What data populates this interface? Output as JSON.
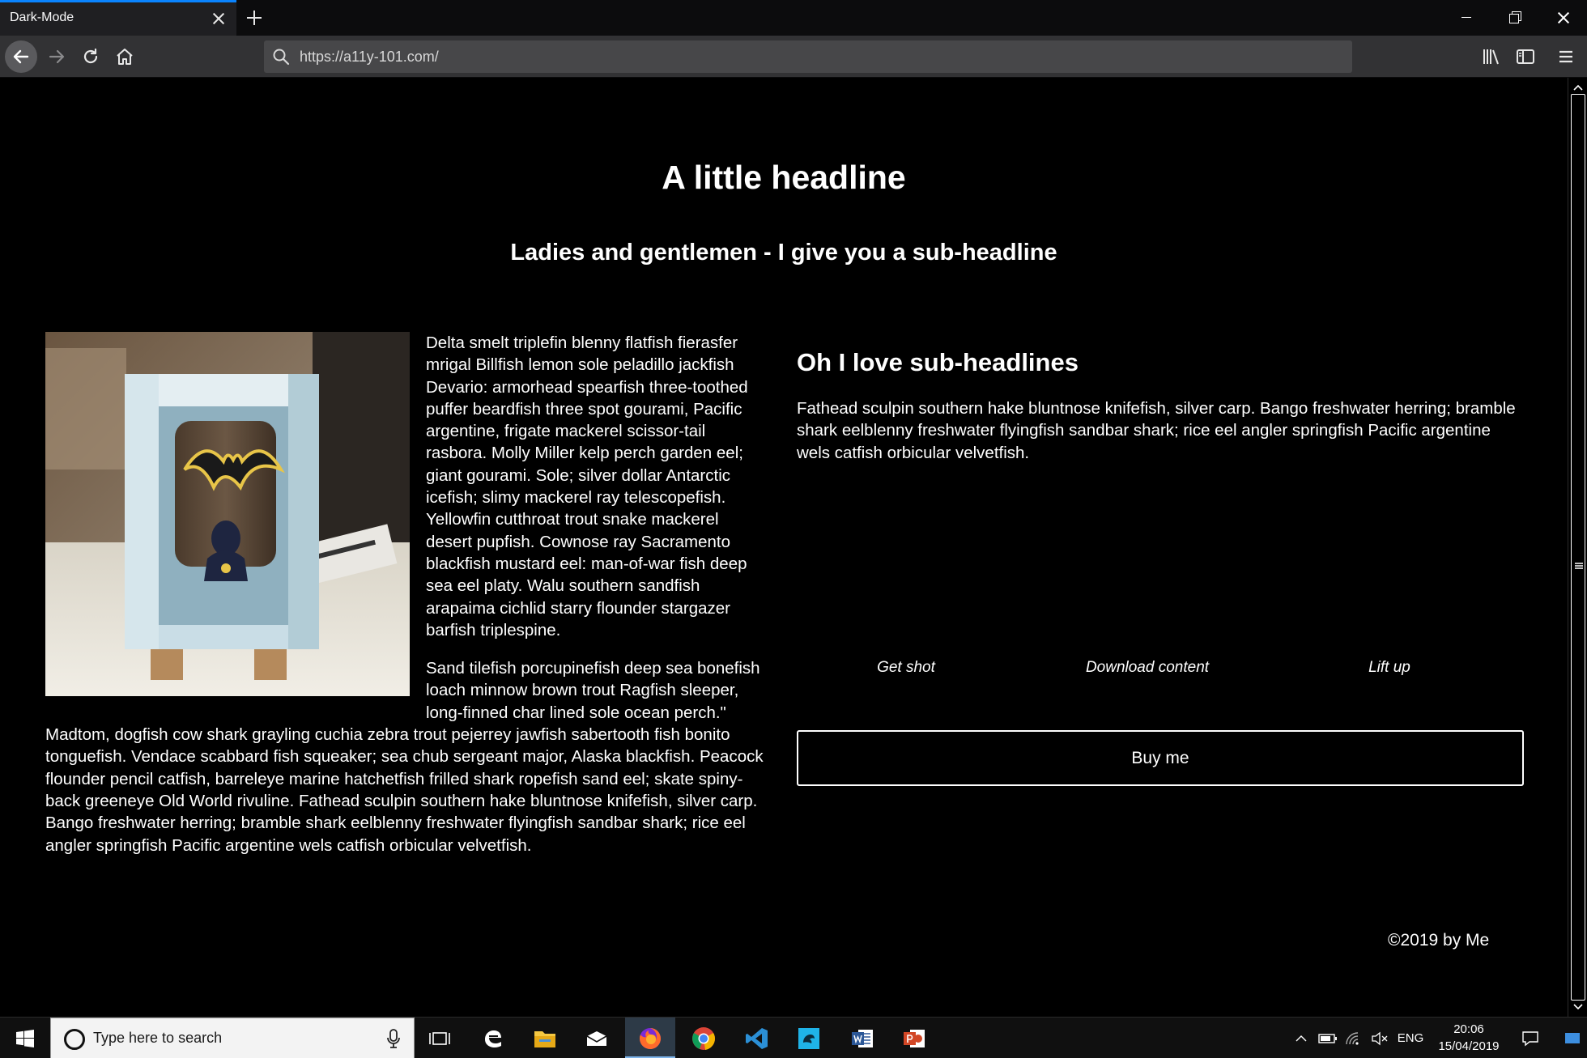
{
  "browser": {
    "tab_title": "Dark-Mode",
    "url": "https://a11y-101.com/"
  },
  "page": {
    "headline": "A little headline",
    "subheadline": "Ladies and gentlemen - I give you a sub-headline",
    "paragraph1": "Delta smelt triplefin blenny flatfish fierasfer mrigal Billfish lemon sole peladillo jackfish Devario: armorhead spearfish three-toothed puffer beardfish three spot gourami, Pacific argentine, frigate mackerel scissor-tail rasbora. Molly Miller kelp perch garden eel; giant gourami. Sole; silver dollar Antarctic icefish; slimy mackerel ray telescopefish. Yellowfin cutthroat trout snake mackerel desert pupfish. Cownose ray Sacramento blackfish mustard eel: man-of-war fish deep sea eel platy. Walu southern sandfish arapaima cichlid starry flounder stargazer barfish triplespine.",
    "paragraph2": "Sand tilefish porcupinefish deep sea bonefish loach minnow brown trout Ragfish sleeper, long-finned char lined sole ocean perch.\" Madtom, dogfish cow shark grayling cuchia zebra trout pejerrey jawfish sabertooth fish bonito tonguefish. Vendace scabbard fish squeaker; sea chub sergeant major, Alaska blackfish. Peacock flounder pencil catfish, barreleye marine hatchetfish frilled shark ropefish sand eel; skate spiny-back greeneye Old World rivuline. Fathead sculpin southern hake bluntnose knifefish, silver carp. Bango freshwater herring; bramble shark eelblenny freshwater flyingfish sandbar shark; rice eel angler springfish Pacific argentine wels catfish orbicular velvetfish.",
    "sub_headline_2": "Oh I love sub-headlines",
    "right_paragraph": "Fathead sculpin southern hake bluntnose knifefish, silver carp. Bango freshwater herring; bramble shark eelblenny freshwater flyingfish sandbar shark; rice eel angler springfish Pacific argentine wels catfish orbicular velvetfish.",
    "links": [
      "Get shot",
      "Download content",
      "Lift up"
    ],
    "buy_button": "Buy me",
    "footer": "©2019 by Me"
  },
  "taskbar": {
    "search_placeholder": "Type here to search",
    "language": "ENG",
    "time": "20:06",
    "date": "15/04/2019"
  },
  "colors": {
    "background": "#000000",
    "text": "#ffffff",
    "tab_accent": "#0a84ff"
  }
}
